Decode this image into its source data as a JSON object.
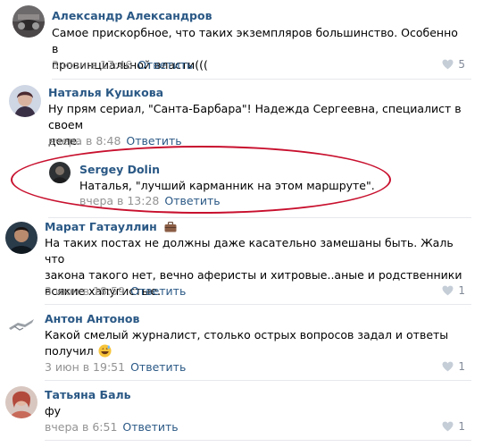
{
  "comments": [
    {
      "author": "Александр Александров",
      "lines": [
        "Самое прискорбное, что таких экземпляров большинство. Особенно в",
        "провинциальной власти((("
      ],
      "date": "3 июн в 17:46",
      "reply": "Ответить",
      "likes": "5"
    },
    {
      "author": "Наталья Кушкова",
      "lines": [
        "Ну прям сериал, \"Санта-Барбара\"! Надежда Сергеевна, специалист в своем",
        "деле."
      ],
      "date": "вчера в 8:48",
      "reply": "Ответить"
    },
    {
      "author": "Sergey Dolin",
      "lines": [
        "Наталья, \"лучший карманник на этом маршруте\"."
      ],
      "date": "вчера в 13:28",
      "reply": "Ответить"
    },
    {
      "author": "Марат Гатауллин",
      "lines": [
        "На таких постах не должны даже касательно замешаны быть. Жаль что",
        "закона такого нет, вечно аферисты и хитровые..аные и родственники",
        "всякие хапугистые."
      ],
      "date": "3 июн в 18:59",
      "reply": "Ответить",
      "likes": "1"
    },
    {
      "author": "Антон Антонов",
      "lines": [
        "Какой смелый журналист, столько острых вопросов задал и ответы",
        "получил"
      ],
      "date": "3 июн в 19:51",
      "reply": "Ответить",
      "likes": "1"
    },
    {
      "author": "Татьяна Баль",
      "lines": [
        "фу"
      ],
      "date": "вчера в 6:51",
      "reply": "Ответить",
      "likes": "1"
    }
  ],
  "icons": {
    "like": "heart-icon",
    "briefcase": "briefcase-icon",
    "emoji": "grinning-sweat-emoji"
  },
  "colors": {
    "link": "#2a5885",
    "meta": "#939393",
    "highlight_oval": "#c8102e",
    "separator": "#e7e8ec"
  }
}
